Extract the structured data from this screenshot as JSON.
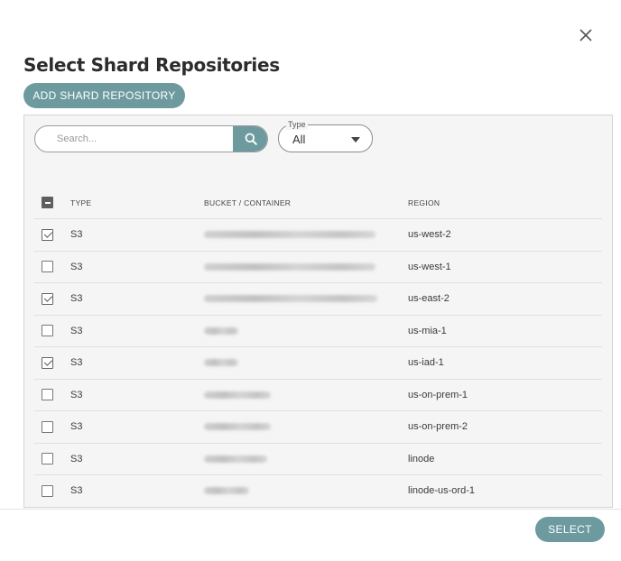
{
  "dialog": {
    "title": "Select Shard Repositories",
    "close_icon": "close-icon"
  },
  "toolbar": {
    "add_label": "ADD SHARD REPOSITORY"
  },
  "search": {
    "placeholder": "Search...",
    "value": "",
    "icon": "search-icon"
  },
  "type_filter": {
    "legend": "Type",
    "selected": "All"
  },
  "table": {
    "columns": [
      "TYPE",
      "BUCKET / CONTAINER",
      "REGION"
    ],
    "header_checkbox_state": "indeterminate",
    "rows": [
      {
        "checked": true,
        "type": "S3",
        "region": "us-west-2"
      },
      {
        "checked": false,
        "type": "S3",
        "region": "us-west-1"
      },
      {
        "checked": true,
        "type": "S3",
        "region": "us-east-2"
      },
      {
        "checked": false,
        "type": "S3",
        "region": "us-mia-1"
      },
      {
        "checked": true,
        "type": "S3",
        "region": "us-iad-1"
      },
      {
        "checked": false,
        "type": "S3",
        "region": "us-on-prem-1"
      },
      {
        "checked": false,
        "type": "S3",
        "region": "us-on-prem-2"
      },
      {
        "checked": false,
        "type": "S3",
        "region": "linode"
      },
      {
        "checked": false,
        "type": "S3",
        "region": "linode-us-ord-1"
      }
    ]
  },
  "footer": {
    "select_label": "SELECT"
  },
  "colors": {
    "accent": "#6d9a9f"
  }
}
